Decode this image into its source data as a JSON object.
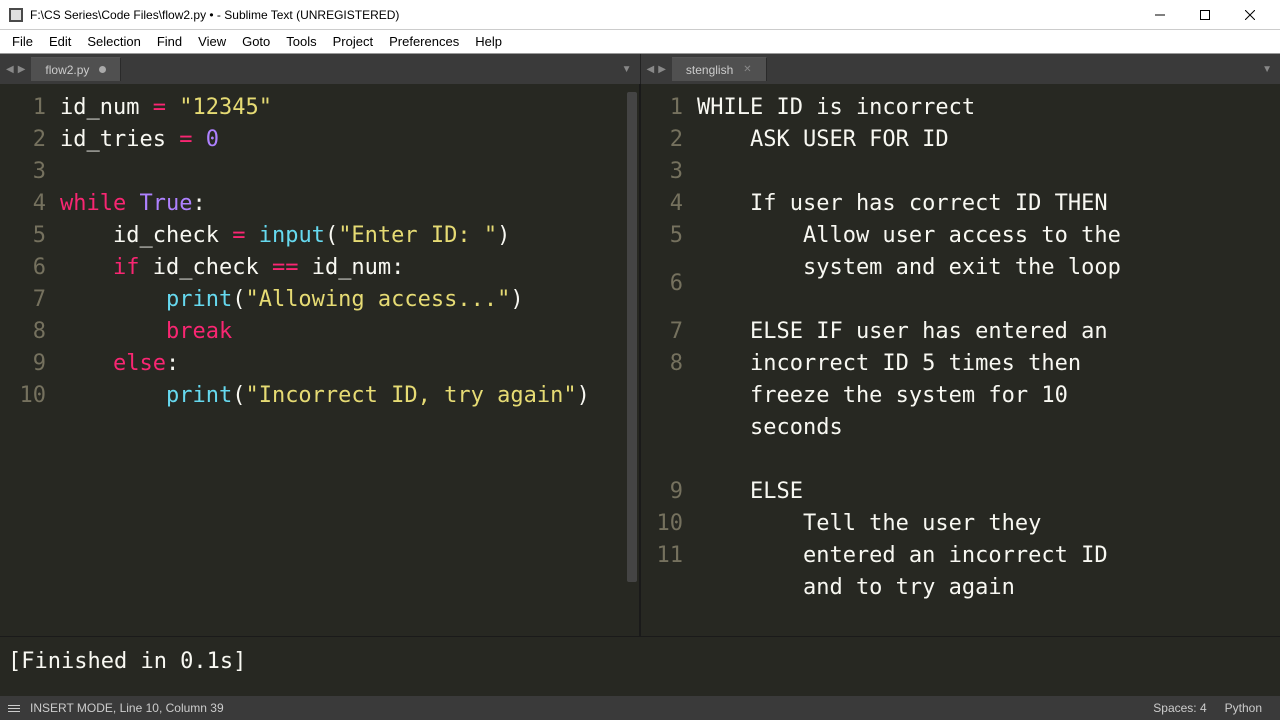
{
  "window": {
    "title": "F:\\CS Series\\Code Files\\flow2.py • - Sublime Text (UNREGISTERED)"
  },
  "menu": [
    "File",
    "Edit",
    "Selection",
    "Find",
    "View",
    "Goto",
    "Tools",
    "Project",
    "Preferences",
    "Help"
  ],
  "left": {
    "tab": "flow2.py",
    "lines": [
      "1",
      "2",
      "3",
      "4",
      "5",
      "6",
      "7",
      "8",
      "9",
      "10"
    ],
    "code": {
      "l1_a": "id_num ",
      "l1_op": "=",
      "l1_b": " ",
      "l1_str": "\"12345\"",
      "l2_a": "id_tries ",
      "l2_op": "=",
      "l2_b": " ",
      "l2_num": "0",
      "l3": "",
      "l4_kw": "while",
      "l4_sp": " ",
      "l4_b": "True",
      "l4_c": ":",
      "l5_ind": "    ",
      "l5_a": "id_check ",
      "l5_op": "=",
      "l5_sp": " ",
      "l5_fn": "input",
      "l5_p1": "(",
      "l5_str": "\"Enter ID: \"",
      "l5_p2": ")",
      "l6_ind": "    ",
      "l6_kw": "if",
      "l6_sp": " ",
      "l6_a": "id_check ",
      "l6_op": "==",
      "l6_b": " id_num:",
      "l7_ind": "        ",
      "l7_fn": "print",
      "l7_p1": "(",
      "l7_str": "\"Allowing access...\"",
      "l7_p2": ")",
      "l8_ind": "        ",
      "l8_kw": "break",
      "l9_ind": "    ",
      "l9_kw": "else",
      "l9_c": ":",
      "l10_ind": "        ",
      "l10_fn": "print",
      "l10_p1": "(",
      "l10_str": "\"Incorrect ID, try again\"",
      "l10_p2": ")"
    }
  },
  "right": {
    "tab": "stenglish",
    "lines": [
      "1",
      "2",
      "3",
      "4",
      "5",
      "6",
      "7",
      "8",
      "9",
      "10",
      "11"
    ],
    "code": {
      "l1": "WHILE ID is incorrect",
      "l2": "    ASK USER FOR ID",
      "l3": "",
      "l4": "    If user has correct ID THEN",
      "l5a": "        Allow user access to the",
      "l5b": "        system and exit the loop",
      "l6": "",
      "l7a": "    ELSE IF user has entered an",
      "l7b": "    incorrect ID 5 times then",
      "l7c": "    freeze the system for 10",
      "l7d": "    seconds",
      "l8": "",
      "l9": "    ELSE",
      "l10a": "        Tell the user they",
      "l10b": "        entered an incorrect ID",
      "l10c": "        and to try again",
      "l11": ""
    }
  },
  "console": "[Finished in 0.1s]",
  "status": {
    "mode": "INSERT MODE, Line 10, Column 39",
    "spaces": "Spaces: 4",
    "lang": "Python"
  }
}
